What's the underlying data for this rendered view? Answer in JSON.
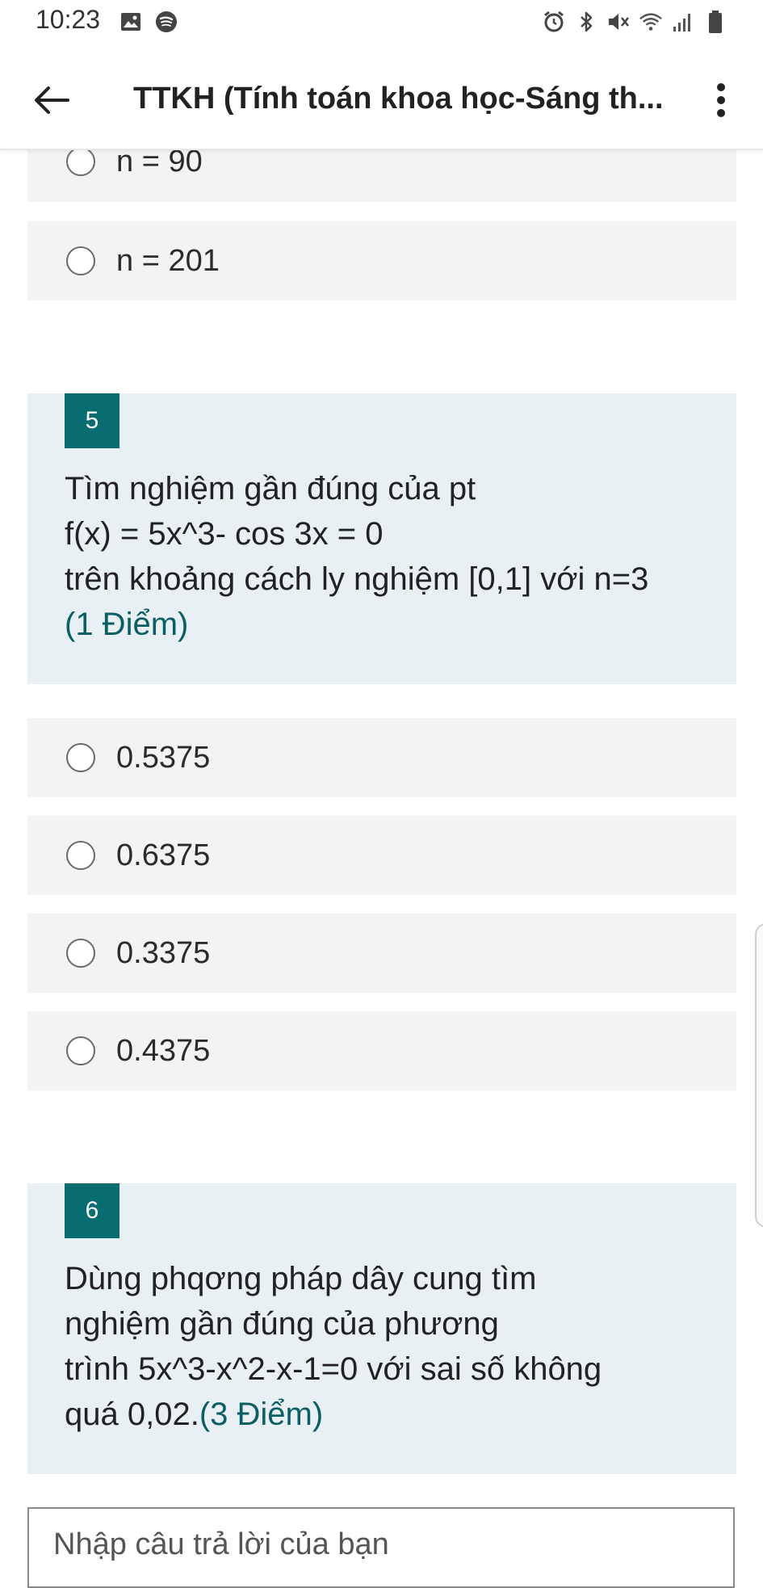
{
  "status_bar": {
    "time": "10:23",
    "left_icons": [
      "gallery-icon",
      "spotify-icon"
    ],
    "right_icons": [
      "alarm-icon",
      "bluetooth-icon",
      "mute-icon",
      "wifi-icon",
      "signal-icon",
      "battery-icon"
    ]
  },
  "app_bar": {
    "title": "TTKH (Tính toán khoa học-Sáng th..."
  },
  "question4_options": [
    {
      "label": "n = 90"
    },
    {
      "label": "n = 201"
    }
  ],
  "question5": {
    "number": "5",
    "lines": [
      "Tìm nghiệm gần đúng của pt",
      "f(x) = 5x^3- cos 3x = 0",
      "trên khoảng cách ly nghiệm [0,1] với n=3"
    ],
    "points": "(1 Điểm)",
    "options": [
      {
        "label": "0.5375"
      },
      {
        "label": "0.6375"
      },
      {
        "label": "0.3375"
      },
      {
        "label": "0.4375"
      }
    ]
  },
  "question6": {
    "number": "6",
    "lines": [
      "Dùng phqơng pháp dây cung tìm",
      "nghiệm gần đúng của phương",
      "trình 5x^3-x^2-x-1=0 với sai số không"
    ],
    "last_line": "quá 0,02.",
    "points": "(3 Điểm)",
    "answer_placeholder": "Nhập câu trả lời của bạn"
  },
  "colors": {
    "accent": "#086c70",
    "card_bg": "#e8f0f3",
    "option_bg": "#f3f3f3",
    "points_text": "#0b5e63"
  }
}
